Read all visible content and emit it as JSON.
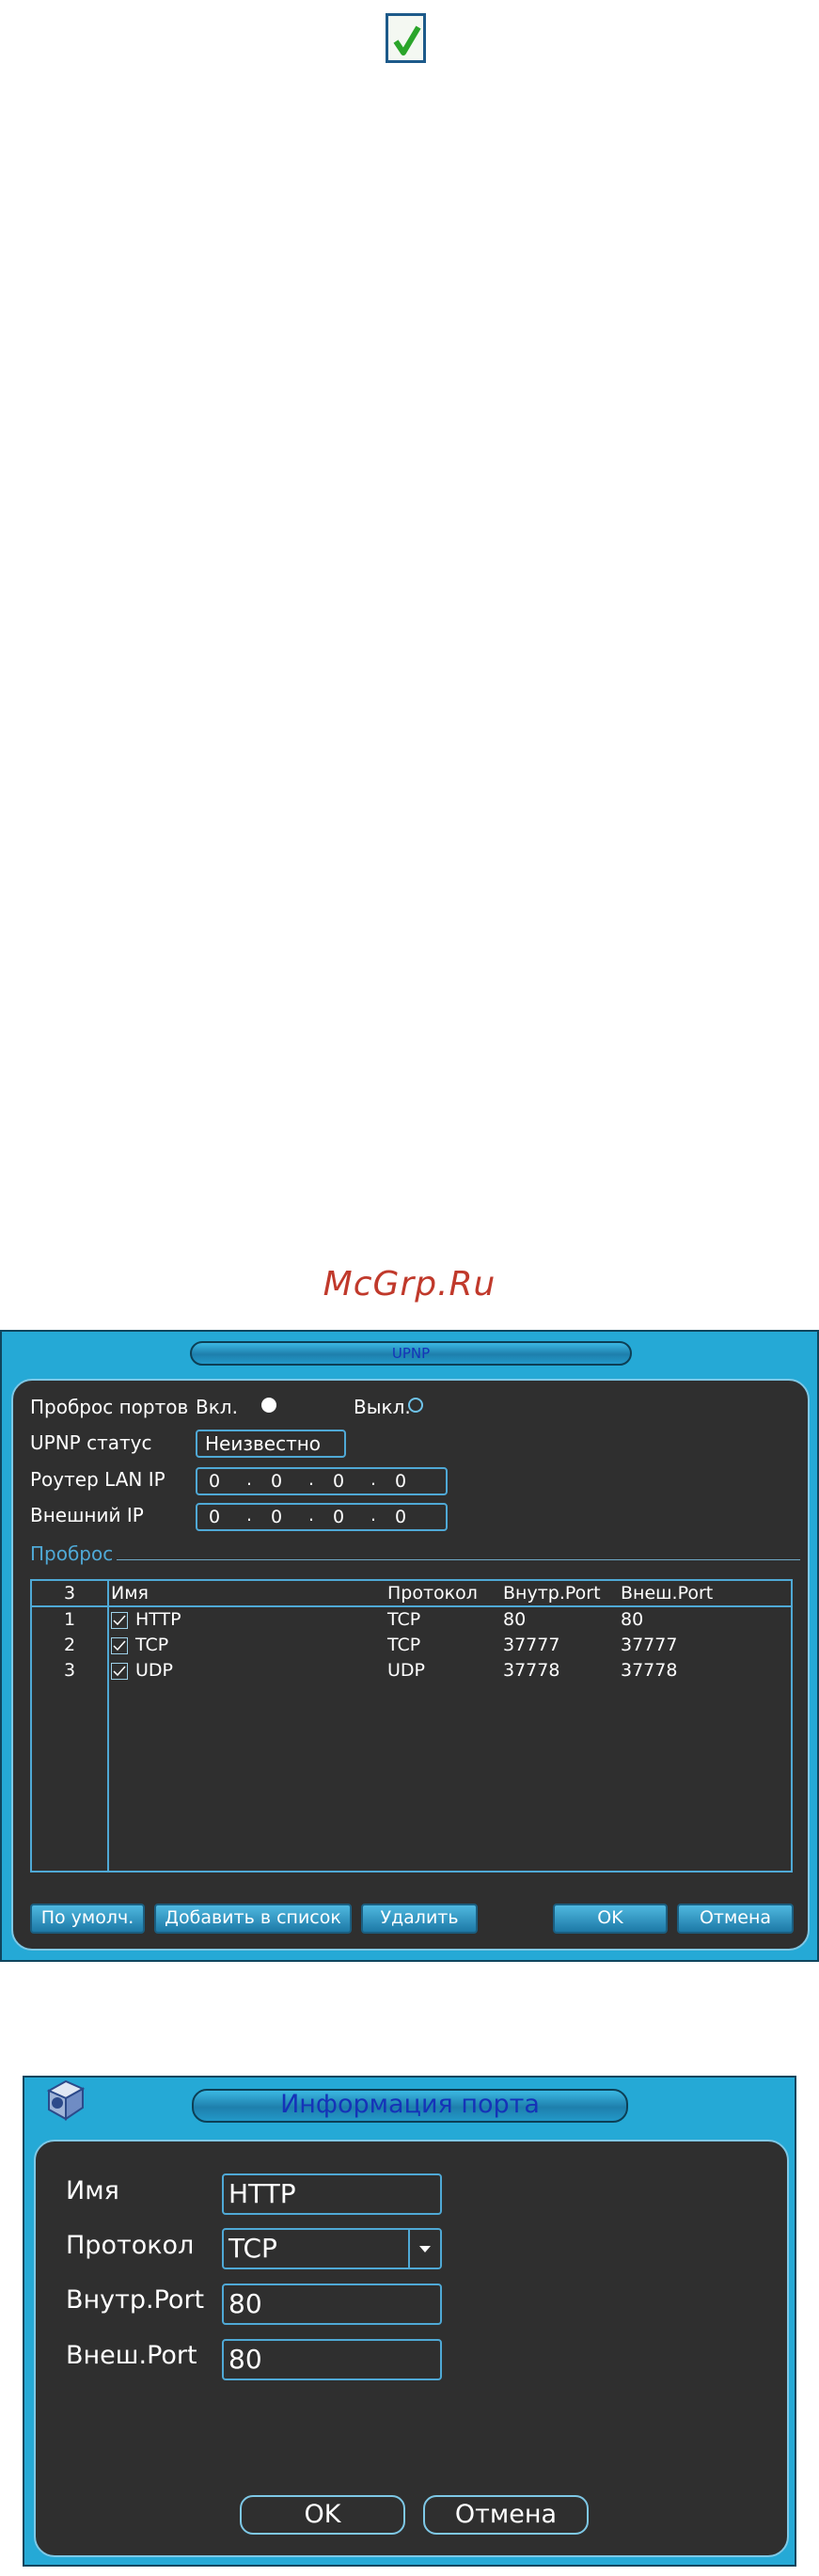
{
  "watermark": "McGrp.Ru",
  "upnp": {
    "title": "UPNP",
    "port_forward_label": "Проброс портов",
    "on_label": "Вкл.",
    "off_label": "Выкл.",
    "selected": "on",
    "status_label": "UPNP статус",
    "status_value": "Неизвестно",
    "router_ip_label": "Роутер LAN IP",
    "router_ip": [
      "0",
      "0",
      "0",
      "0"
    ],
    "ext_ip_label": "Внешний IP",
    "ext_ip": [
      "0",
      "0",
      "0",
      "0"
    ],
    "section_label": "Проброс",
    "table": {
      "headers": [
        "3",
        "Имя",
        "Протокол",
        "Внутр.Port",
        "Внеш.Port"
      ],
      "rows": [
        {
          "num": "1",
          "checked": true,
          "name": "HTTP",
          "proto": "TCP",
          "int": "80",
          "ext": "80"
        },
        {
          "num": "2",
          "checked": true,
          "name": "TCP",
          "proto": "TCP",
          "int": "37777",
          "ext": "37777"
        },
        {
          "num": "3",
          "checked": true,
          "name": "UDP",
          "proto": "UDP",
          "int": "37778",
          "ext": "37778"
        }
      ]
    },
    "buttons": {
      "default": "По умолч.",
      "add": "Добавить в список",
      "delete": "Удалить",
      "ok": "OK",
      "cancel": "Отмена"
    }
  },
  "port_info": {
    "title": "Информация порта",
    "name_label": "Имя",
    "name_value": "HTTP",
    "protocol_label": "Протокол",
    "protocol_value": "TCP",
    "int_label": "Внутр.Port",
    "int_value": "80",
    "ext_label": "Внеш.Port",
    "ext_value": "80",
    "ok": "OK",
    "cancel": "Отмена"
  },
  "colors": {
    "frame": "#25a9d6",
    "panel": "#2f2f2f",
    "title_text": "#1533b8",
    "checkmark": "#2aa52a"
  }
}
